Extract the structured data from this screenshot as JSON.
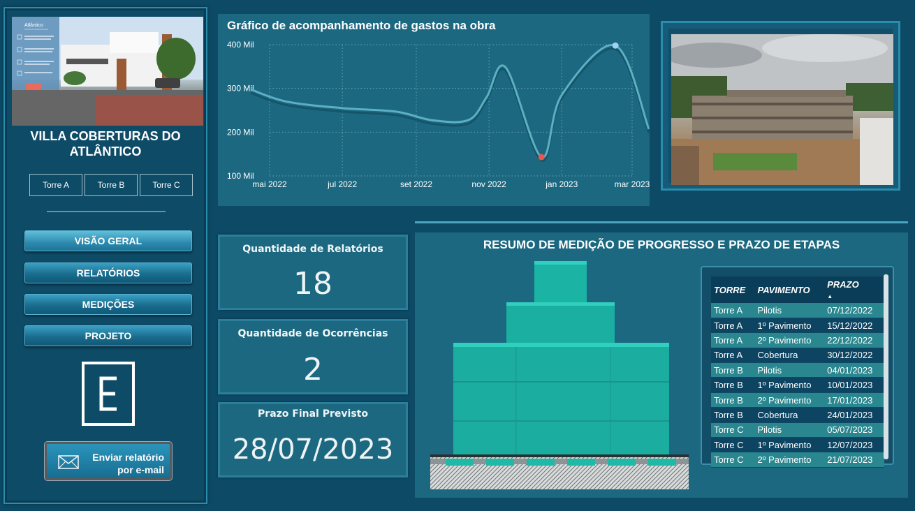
{
  "project": {
    "title": "VILLA COBERTURAS DO ATLÂNTICO",
    "photo_brand": "Atlântico"
  },
  "towers": [
    "Torre A",
    "Torre B",
    "Torre C"
  ],
  "nav": {
    "visao_geral": "VISÃO GERAL",
    "relatorios": "RELATÓRIOS",
    "medicoes": "MEDIÇÕES",
    "projeto": "PROJETO"
  },
  "email_button": {
    "line1": "Enviar relatório",
    "line2": "por e-mail"
  },
  "chart_data": {
    "type": "line",
    "title": "Gráfico de acompanhamento de gastos na obra",
    "x": [
      "2022-04-15",
      "2022-05-15",
      "2022-07-01",
      "2022-08-15",
      "2022-09-15",
      "2022-10-15",
      "2022-10-30",
      "2022-11-15",
      "2022-12-15",
      "2023-01-01",
      "2023-02-15",
      "2023-03-15"
    ],
    "x_tick_labels": [
      "mai 2022",
      "jul 2022",
      "set 2022",
      "nov 2022",
      "jan 2023",
      "mar 2023"
    ],
    "series": [
      {
        "values": [
          298,
          270,
          255,
          247,
          227,
          228,
          280,
          348,
          143,
          285,
          398,
          207
        ]
      }
    ],
    "y_tick_labels": [
      "400 Mil",
      "300 Mil",
      "200 Mil",
      "100 Mil"
    ],
    "ylim": [
      100,
      400
    ],
    "highlight_max_color": "#9fd3f0",
    "highlight_min_color": "#e5574f",
    "line_color": "#5bb0c3",
    "grid": true
  },
  "kpis": [
    {
      "label": "Quantidade de Relatórios",
      "value": "18"
    },
    {
      "label": "Quantidade de Ocorrências",
      "value": "2"
    },
    {
      "label": "Prazo Final Previsto",
      "value": "28/07/2023"
    }
  ],
  "progress": {
    "title": "RESUMO DE MEDIÇÃO DE PROGRESSO E PRAZO DE ETAPAS",
    "columns": [
      "TORRE",
      "PAVIMENTO",
      "PRAZO"
    ],
    "rows": [
      [
        "Torre A",
        "Pilotis",
        "07/12/2022"
      ],
      [
        "Torre A",
        "1º Pavimento",
        "15/12/2022"
      ],
      [
        "Torre A",
        "2º Pavimento",
        "22/12/2022"
      ],
      [
        "Torre A",
        "Cobertura",
        "30/12/2022"
      ],
      [
        "Torre B",
        "Pilotis",
        "04/01/2023"
      ],
      [
        "Torre B",
        "1º Pavimento",
        "10/01/2023"
      ],
      [
        "Torre B",
        "2º Pavimento",
        "17/01/2023"
      ],
      [
        "Torre B",
        "Cobertura",
        "24/01/2023"
      ],
      [
        "Torre C",
        "Pilotis",
        "05/07/2023"
      ],
      [
        "Torre C",
        "1º Pavimento",
        "12/07/2023"
      ],
      [
        "Torre C",
        "2º Pavimento",
        "21/07/2023"
      ]
    ]
  },
  "colors": {
    "background": "#0c4a66",
    "panel": "#1c6880",
    "accent": "#2b8cab",
    "building_fill": "#1bb3a3"
  }
}
